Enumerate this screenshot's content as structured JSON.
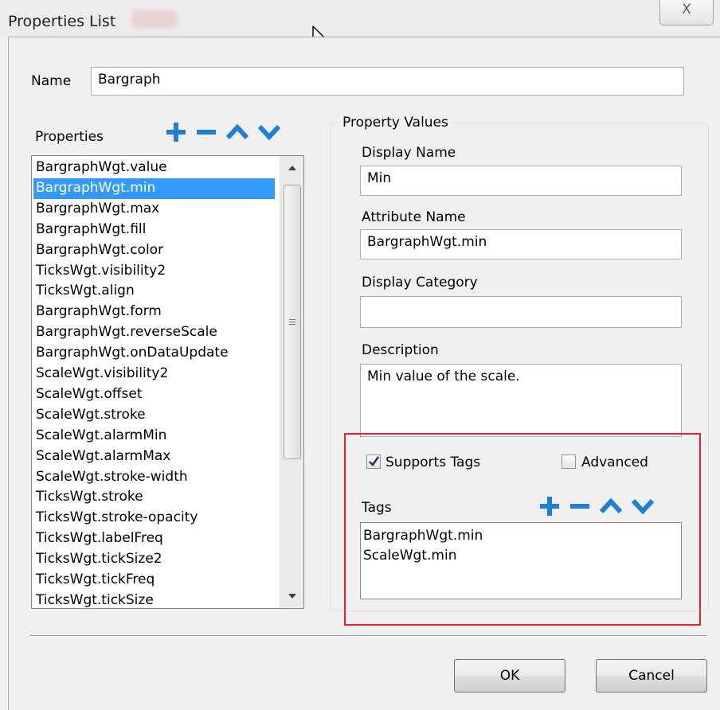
{
  "window": {
    "title": "Properties List",
    "close_glyph": "X"
  },
  "name_field": {
    "label": "Name",
    "value": "Bargraph"
  },
  "properties": {
    "label": "Properties",
    "toolbar_icons": [
      "plus-icon",
      "minus-icon",
      "chevron-up-icon",
      "chevron-down-icon"
    ],
    "selected_index": 1,
    "items": [
      "BargraphWgt.value",
      "BargraphWgt.min",
      "BargraphWgt.max",
      "BargraphWgt.fill",
      "BargraphWgt.color",
      "TicksWgt.visibility2",
      "TicksWgt.align",
      "BargraphWgt.form",
      "BargraphWgt.reverseScale",
      "BargraphWgt.onDataUpdate",
      "ScaleWgt.visibility2",
      "ScaleWgt.offset",
      "ScaleWgt.stroke",
      "ScaleWgt.alarmMin",
      "ScaleWgt.alarmMax",
      "ScaleWgt.stroke-width",
      "TicksWgt.stroke",
      "TicksWgt.stroke-opacity",
      "TicksWgt.labelFreq",
      "TicksWgt.tickSize2",
      "TicksWgt.tickFreq",
      "TicksWgt.tickSize"
    ]
  },
  "property_values": {
    "group_title": "Property Values",
    "display_name": {
      "label": "Display Name",
      "value": "Min"
    },
    "attribute_name": {
      "label": "Attribute Name",
      "value": "BargraphWgt.min"
    },
    "display_category": {
      "label": "Display Category",
      "value": ""
    },
    "description": {
      "label": "Description",
      "value": "Min value of the scale."
    },
    "supports_tags": {
      "label": "Supports Tags",
      "checked": true
    },
    "advanced": {
      "label": "Advanced",
      "checked": false
    },
    "tags": {
      "label": "Tags",
      "toolbar_icons": [
        "plus-icon",
        "minus-icon",
        "chevron-up-icon",
        "chevron-down-icon"
      ],
      "items": [
        "BargraphWgt.min",
        "ScaleWgt.min"
      ]
    }
  },
  "buttons": {
    "ok": "OK",
    "cancel": "Cancel"
  },
  "colors": {
    "icon_blue": "#1e7fd6",
    "selection": "#3399ff",
    "highlight_red": "#e8202c"
  }
}
